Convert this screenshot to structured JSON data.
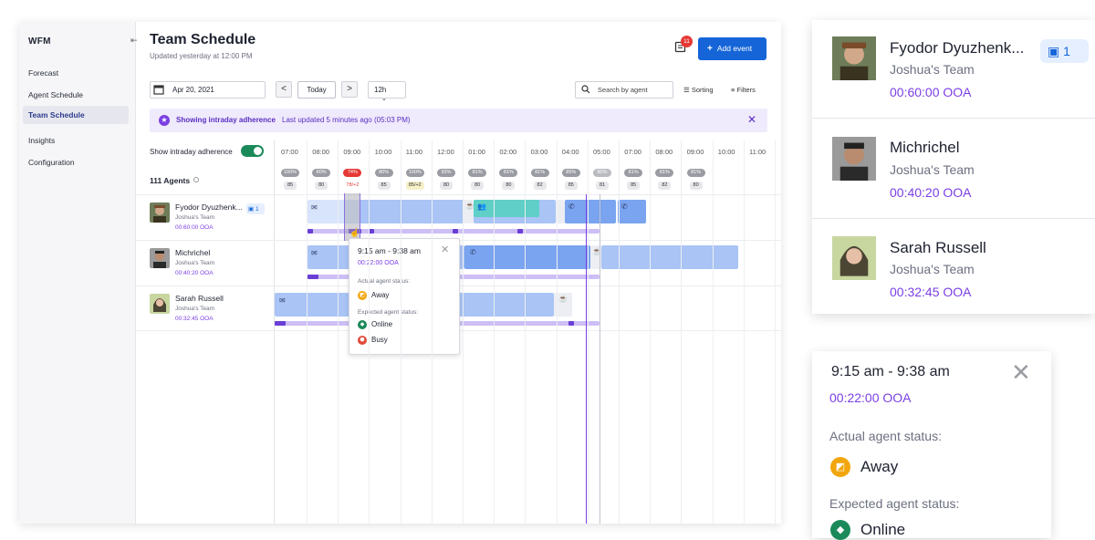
{
  "sidebar": {
    "brand": "WFM",
    "collapse_icon": "collapse-icon",
    "items": [
      {
        "label": "Forecast",
        "active": false
      },
      {
        "label": "Agent Schedule",
        "active": false
      },
      {
        "label": "Team Schedule",
        "active": true
      },
      {
        "label": "Insights",
        "active": false
      },
      {
        "label": "Configuration",
        "active": false
      }
    ]
  },
  "header": {
    "title": "Team Schedule",
    "subtitle": "Updated yesterday at 12:00 PM",
    "notification_count": "11",
    "add_event_label": "Add event"
  },
  "toolbar": {
    "date": "Apr 20, 2021",
    "prev": "<",
    "today_label": "Today",
    "next": ">",
    "zoom": "12h",
    "search_placeholder": "Search by agent",
    "sorting_label": "Sorting",
    "filters_label": "Filters"
  },
  "banner": {
    "bold_text": "Showing intraday adherence",
    "text": "Last updated 5 minutes ago (05:03 PM)",
    "close": "✕"
  },
  "adherence": {
    "toggle_label": "Show intraday adherence",
    "toggle_on": true,
    "agents_count": "111 Agents"
  },
  "timeline": {
    "hours": [
      "07:00",
      "08:00",
      "09:00",
      "10:00",
      "11:00",
      "12:00",
      "01:00",
      "02:00",
      "03:00",
      "04:00",
      "05:00",
      "07:00",
      "08:00",
      "09:00",
      "10:00",
      "11:00",
      "12"
    ],
    "percentages": [
      "100%",
      "80%",
      "74%",
      "80%",
      "100%",
      "93%",
      "81%",
      "81%",
      "81%",
      "85%",
      "80%",
      "81%",
      "81%",
      "81%"
    ],
    "counts": [
      "85",
      "80",
      "78/+2",
      "85",
      "85/+2",
      "80",
      "80",
      "80",
      "82",
      "85",
      "81",
      "85",
      "82",
      "80"
    ]
  },
  "agents": [
    {
      "name": "Fyodor Dyuzhenk...",
      "team": "Joshua's Team",
      "ooa": "00:60:00 OOA",
      "events": "1"
    },
    {
      "name": "Michrichel",
      "team": "Joshua's Team",
      "ooa": "00:40:20 OOA"
    },
    {
      "name": "Sarah Russell",
      "team": "Joshua's Team",
      "ooa": "00:32:45 OOA"
    }
  ],
  "tooltip": {
    "range": "9:15 am - 9:38 am",
    "ooa": "00:22:00 OOA",
    "actual_label": "Actual agent status:",
    "actual_value": "Away",
    "expected_label": "Expected agent status:",
    "expected_values": [
      "Online",
      "Busy"
    ]
  },
  "zoom_tooltip": {
    "range": "9:15 am - 9:38 am",
    "ooa": "00:22:00 OOA",
    "actual_label": "Actual agent status:",
    "actual_value": "Away",
    "expected_label": "Expected agent status:",
    "expected_value": "Online"
  },
  "colors": {
    "primary": "#1565d8",
    "purple": "#7b3fe4",
    "green": "#1b8a5a",
    "away": "#f2a60d",
    "busy": "#e04a3b"
  }
}
